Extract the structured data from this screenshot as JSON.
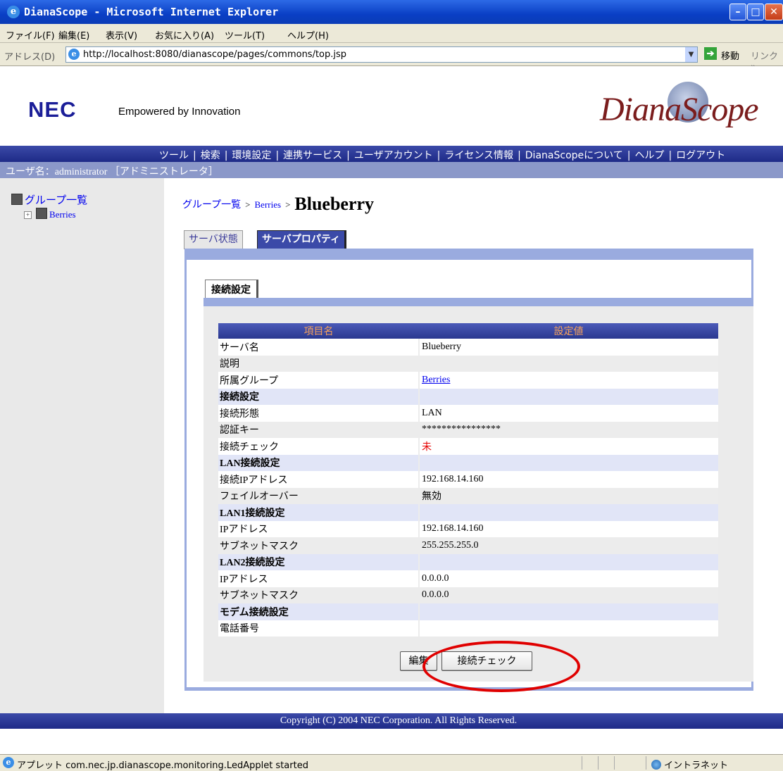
{
  "window": {
    "title": "DianaScope - Microsoft Internet Explorer"
  },
  "menu": [
    "ファイル(F)",
    "編集(E)",
    "表示(V)",
    "お気に入り(A)",
    "ツール(T)",
    "ヘルプ(H)"
  ],
  "address": {
    "label": "アドレス(D)",
    "url": "http://localhost:8080/dianascope/pages/commons/top.jsp",
    "go": "移動",
    "links": "リンク »"
  },
  "header": {
    "logo": "NEC",
    "tagline": "Empowered by Innovation",
    "product_logo": "DianaScope"
  },
  "nav": [
    "ツール",
    "検索",
    "環境設定",
    "連携サービス",
    "ユーザアカウント",
    "ライセンス情報",
    "DianaScopeについて",
    "ヘルプ",
    "ログアウト"
  ],
  "user": "ユーザ名：administrator ［アドミニストレータ］",
  "sidebar": {
    "root": "グループ一覧",
    "child": "Berries"
  },
  "breadcrumb": {
    "root": "グループ一覧",
    "group": "Berries",
    "current": "Blueberry",
    "sep": ">"
  },
  "tabs": [
    "サーバ状態",
    "サーバプロパティ"
  ],
  "subtab": "接続設定",
  "table": {
    "headers": [
      "項目名",
      "設定値"
    ],
    "rows": [
      {
        "label": "サーバ名",
        "value": "Blueberry"
      },
      {
        "label": "説明",
        "value": ""
      },
      {
        "label": "所属グループ",
        "value": "Berries"
      },
      {
        "label": "接続設定",
        "value": ""
      },
      {
        "label": "接続形態",
        "value": "LAN"
      },
      {
        "label": "認証キー",
        "value": "****************"
      },
      {
        "label": "接続チェック",
        "value": "未"
      },
      {
        "label": "LAN接続設定",
        "value": ""
      },
      {
        "label": "接続IPアドレス",
        "value": "192.168.14.160"
      },
      {
        "label": "フェイルオーバー",
        "value": "無効"
      },
      {
        "label": "LAN1接続設定",
        "value": ""
      },
      {
        "label": "IPアドレス",
        "value": "192.168.14.160"
      },
      {
        "label": "サブネットマスク",
        "value": "255.255.255.0"
      },
      {
        "label": "LAN2接続設定",
        "value": ""
      },
      {
        "label": "IPアドレス",
        "value": "0.0.0.0"
      },
      {
        "label": "サブネットマスク",
        "value": "0.0.0.0"
      },
      {
        "label": "モデム接続設定",
        "value": ""
      },
      {
        "label": "電話番号",
        "value": ""
      }
    ]
  },
  "buttons": {
    "edit": "編集",
    "check": "接続チェック"
  },
  "footer": "Copyright (C) 2004 NEC Corporation. All Rights Reserved.",
  "status": {
    "message": "アプレット com.nec.jp.dianascope.monitoring.LedApplet started",
    "zone": "イントラネット"
  },
  "colors": {
    "title_blue": "#0a3fc5",
    "nav_blue": "#2a388f",
    "header_text": "#f5a15c",
    "highlight": "#e00000"
  }
}
